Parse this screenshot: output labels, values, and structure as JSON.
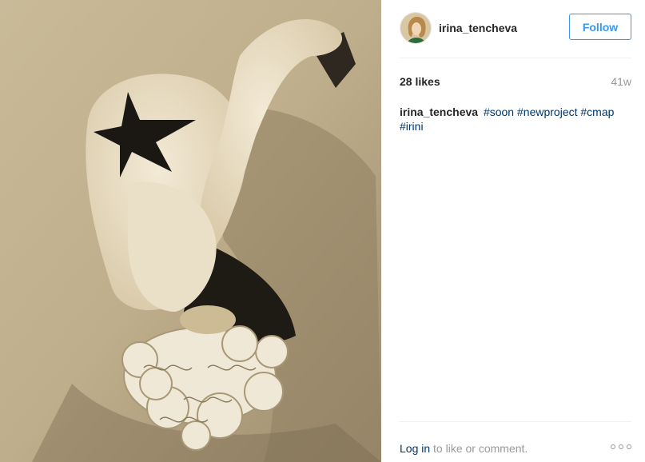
{
  "post": {
    "username": "irina_tencheva",
    "follow_label": "Follow",
    "likes": "28 likes",
    "time_ago": "41w",
    "caption": {
      "username": "irina_tencheva",
      "tags": [
        "#soon",
        "#newproject",
        "#cmap",
        "#irini"
      ]
    },
    "footer": {
      "login_label": "Log in",
      "rest_label": " to like or comment."
    }
  },
  "colors": {
    "accent": "#3897f0",
    "link": "#003569",
    "muted": "#999999"
  },
  "icons": [
    "avatar-photo",
    "more-options-icon"
  ]
}
